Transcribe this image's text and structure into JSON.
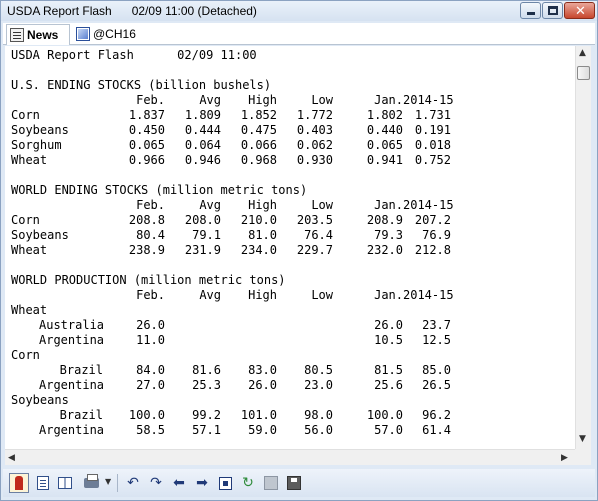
{
  "window": {
    "title": "USDA Report Flash      02/09 11:00 (Detached)"
  },
  "tabs": [
    {
      "label": "News",
      "icon": "news-icon"
    },
    {
      "label": "@CH16",
      "icon": "chart-icon"
    }
  ],
  "report": {
    "header": "USDA Report Flash      02/09 11:00",
    "sections": {
      "us_stocks": {
        "title": "U.S. ENDING STOCKS (billion bushels)",
        "columns": [
          "Feb.",
          "Avg",
          "High",
          "Low",
          "Jan.",
          "2014-15"
        ],
        "rows": [
          {
            "label": "Corn",
            "values": [
              "1.837",
              "1.809",
              "1.852",
              "1.772",
              "1.802",
              "1.731"
            ]
          },
          {
            "label": "Soybeans",
            "values": [
              "0.450",
              "0.444",
              "0.475",
              "0.403",
              "0.440",
              "0.191"
            ]
          },
          {
            "label": "Sorghum",
            "values": [
              "0.065",
              "0.064",
              "0.066",
              "0.062",
              "0.065",
              "0.018"
            ]
          },
          {
            "label": "Wheat",
            "values": [
              "0.966",
              "0.946",
              "0.968",
              "0.930",
              "0.941",
              "0.752"
            ]
          }
        ]
      },
      "world_stocks": {
        "title": "WORLD ENDING STOCKS (million metric tons)",
        "columns": [
          "Feb.",
          "Avg",
          "High",
          "Low",
          "Jan.",
          "2014-15"
        ],
        "rows": [
          {
            "label": "Corn",
            "values": [
              "208.8",
              "208.0",
              "210.0",
              "203.5",
              "208.9",
              "207.2"
            ]
          },
          {
            "label": "Soybeans",
            "values": [
              "80.4",
              "79.1",
              "81.0",
              "76.4",
              "79.3",
              "76.9"
            ]
          },
          {
            "label": "Wheat",
            "values": [
              "238.9",
              "231.9",
              "234.0",
              "229.7",
              "232.0",
              "212.8"
            ]
          }
        ]
      },
      "world_production": {
        "title": "WORLD PRODUCTION (million metric tons)",
        "columns": [
          "Feb.",
          "Avg",
          "High",
          "Low",
          "Jan.",
          "2014-15"
        ],
        "groups": [
          {
            "name": "Wheat",
            "rows": [
              {
                "label": "Australia",
                "values": [
                  "26.0",
                  "",
                  "",
                  "",
                  "26.0",
                  "23.7"
                ]
              },
              {
                "label": "Argentina",
                "values": [
                  "11.0",
                  "",
                  "",
                  "",
                  "10.5",
                  "12.5"
                ]
              }
            ]
          },
          {
            "name": "Corn",
            "rows": [
              {
                "label": "Brazil",
                "values": [
                  "84.0",
                  "81.6",
                  "83.0",
                  "80.5",
                  "81.5",
                  "85.0"
                ]
              },
              {
                "label": "Argentina",
                "values": [
                  "27.0",
                  "25.3",
                  "26.0",
                  "23.0",
                  "25.6",
                  "26.5"
                ]
              }
            ]
          },
          {
            "name": "Soybeans",
            "rows": [
              {
                "label": "Brazil",
                "values": [
                  "100.0",
                  "99.2",
                  "101.0",
                  "98.0",
                  "100.0",
                  "96.2"
                ]
              },
              {
                "label": "Argentina",
                "values": [
                  "58.5",
                  "57.1",
                  "59.0",
                  "56.0",
                  "57.0",
                  "61.4"
                ]
              }
            ]
          }
        ]
      }
    }
  },
  "toolbar": {
    "icons": [
      "pin-icon",
      "single-page-icon",
      "split-view-icon",
      "print-icon",
      "back-icon",
      "forward-icon",
      "left-arrow-icon",
      "right-arrow-icon",
      "fit-icon",
      "refresh-icon",
      "rss-icon",
      "save-icon"
    ]
  }
}
